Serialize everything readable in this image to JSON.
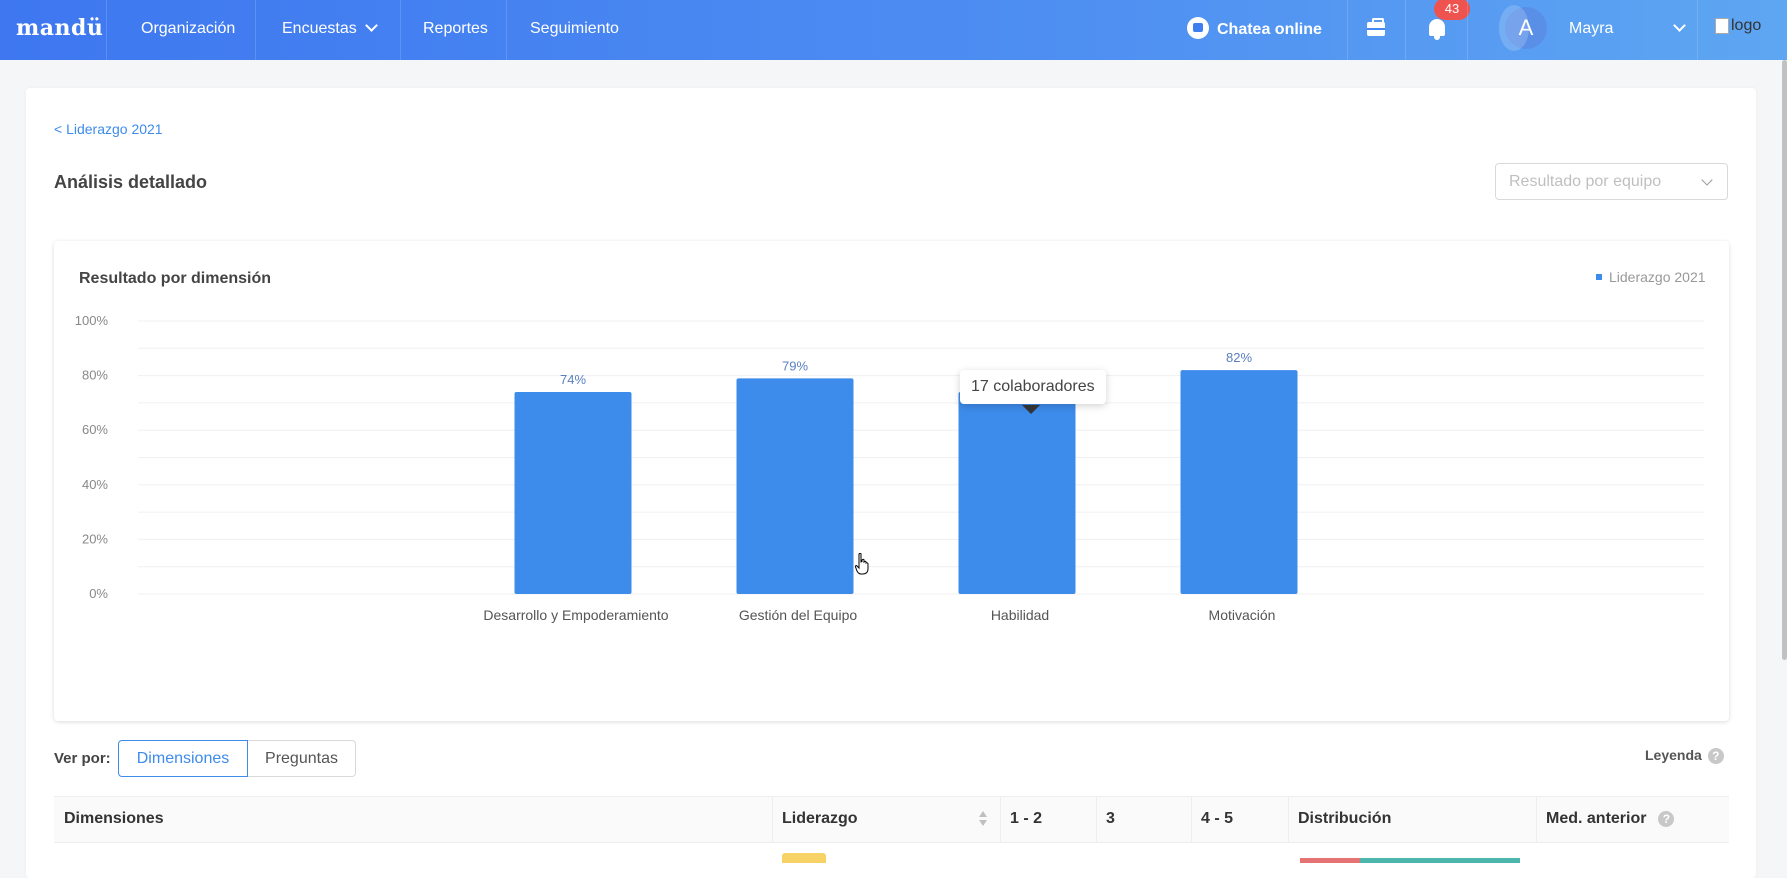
{
  "nav": {
    "brand": "mandü",
    "items": [
      "Organización",
      "Encuestas",
      "Reportes",
      "Seguimiento"
    ],
    "chat_label": "Chatea online",
    "notifications_count": "43",
    "avatar_initial": "A",
    "user_name": "Mayra",
    "logo_alt": "logo"
  },
  "page": {
    "breadcrumb": "< Liderazgo 2021",
    "title": "Análisis detallado",
    "team_select_placeholder": "Resultado por equipo"
  },
  "chart_card": {
    "title": "Resultado por dimensión",
    "legend_label": "Liderazgo 2021",
    "tooltip": "17 colaboradores"
  },
  "chart_data": {
    "type": "bar",
    "categories": [
      "Desarrollo y Empoderamiento",
      "Gestión del Equipo",
      "Habilidad",
      "Motivación"
    ],
    "series": [
      {
        "name": "Liderazgo 2021",
        "values": [
          74,
          79,
          74,
          82
        ]
      }
    ],
    "data_labels": [
      "74%",
      "79%",
      "74%",
      "82%"
    ],
    "y_ticks": [
      "0%",
      "20%",
      "40%",
      "60%",
      "80%",
      "100%"
    ],
    "ylim": [
      0,
      100
    ],
    "bar_color": "#3d8bea",
    "grid": true,
    "legend_position": "top-right"
  },
  "view": {
    "label": "Ver por:",
    "options": [
      "Dimensiones",
      "Preguntas"
    ],
    "selected": "Dimensiones",
    "legend_link": "Leyenda",
    "help_glyph": "?"
  },
  "table": {
    "headers": [
      "Dimensiones",
      "Liderazgo",
      "1 - 2",
      "3",
      "4 - 5",
      "Distribución",
      "Med. anterior"
    ]
  }
}
